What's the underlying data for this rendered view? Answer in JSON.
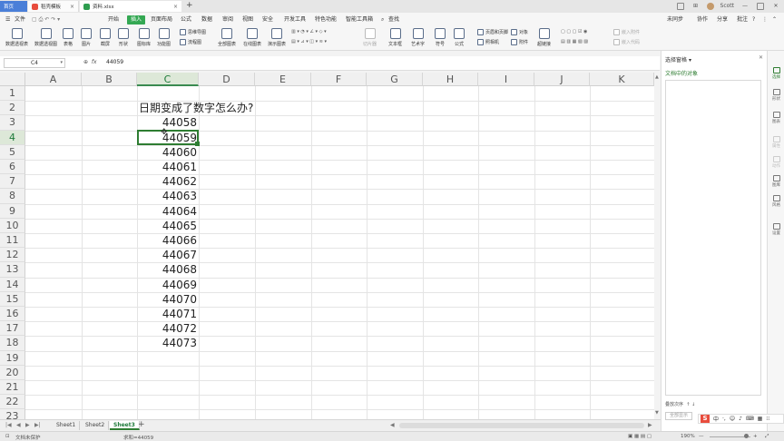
{
  "titlebar": {
    "tabs": [
      {
        "label": "首页"
      },
      {
        "label": "稻壳模板"
      },
      {
        "label": "资料.xlsx"
      }
    ],
    "user": "Scott"
  },
  "menubar": {
    "file": "文件",
    "items": [
      "开始",
      "插入",
      "页面布局",
      "公式",
      "数据",
      "审阅",
      "视图",
      "安全",
      "开发工具",
      "特色功能",
      "智能工具箱"
    ],
    "search": "查找",
    "sync": "未同步",
    "collab": "协作",
    "share": "分享",
    "annotate": "批注"
  },
  "ribbon": {
    "buttons": [
      "数据透视表",
      "数据透视图",
      "表格",
      "图片",
      "截屏",
      "形状",
      "图标库",
      "功能图",
      "全部图表",
      "在线图表",
      "演示图表",
      "切片器",
      "文本框",
      "艺术字",
      "符号",
      "公式",
      "超链接"
    ],
    "small": [
      "思维导图",
      "流程图",
      "页眉和页脚",
      "照相机",
      "对象",
      "附件",
      "窗体",
      "嵌入附件",
      "嵌入代码"
    ]
  },
  "formula": {
    "namebox": "C4",
    "fx": "fx",
    "value": "44059"
  },
  "sheet": {
    "columns": [
      "A",
      "B",
      "C",
      "D",
      "E",
      "F",
      "G",
      "H",
      "I",
      "J",
      "K"
    ],
    "rows": [
      "1",
      "2",
      "3",
      "4",
      "5",
      "6",
      "7",
      "8",
      "9",
      "10",
      "11",
      "12",
      "13",
      "14",
      "15",
      "16",
      "17",
      "18",
      "19",
      "20",
      "21",
      "22",
      "23"
    ],
    "title_cell": "日期变成了数字怎么办?",
    "values": [
      "44058",
      "44059",
      "44060",
      "44061",
      "44062",
      "44063",
      "44064",
      "44065",
      "44066",
      "44067",
      "44068",
      "44069",
      "44070",
      "44071",
      "44072",
      "44073"
    ]
  },
  "sheet_tabs": [
    "Sheet1",
    "Sheet2",
    "Sheet3"
  ],
  "statusbar": {
    "protect": "文档未保护",
    "info": "求和=44059",
    "zoom": "190%"
  },
  "panel": {
    "title": "选择窗格",
    "subtitle": "文档中的对象",
    "order": "叠放次序",
    "show_all": "全部显示",
    "icons": [
      "选择",
      "形状",
      "图表",
      "属性",
      "动作",
      "图库",
      "风格",
      "设置"
    ]
  },
  "ime": {
    "lang": "中"
  }
}
